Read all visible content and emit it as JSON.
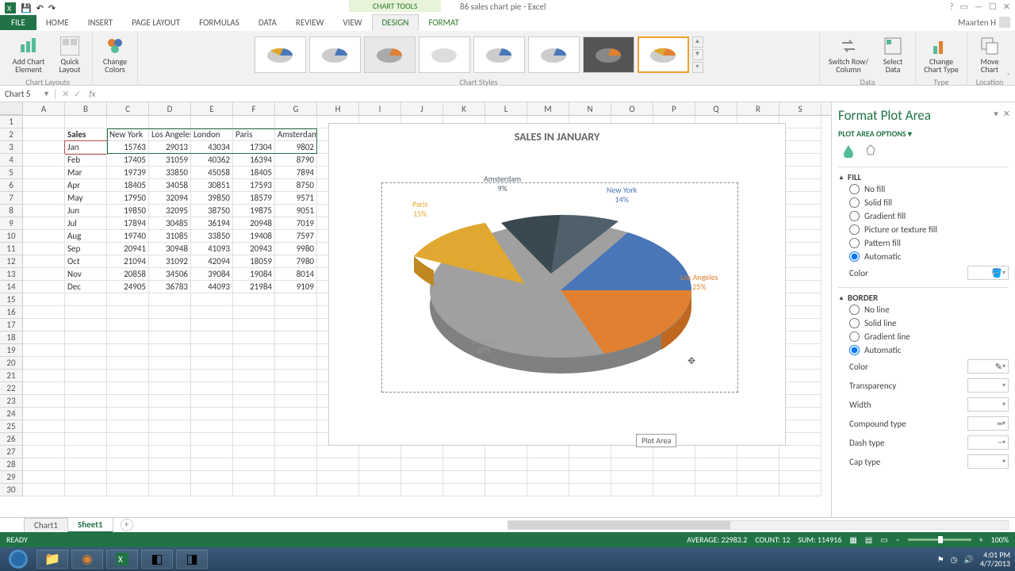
{
  "app": {
    "chart_tools": "CHART TOOLS",
    "doc_title": "86 sales chart pie - Excel",
    "user": "Maarten H"
  },
  "ribbon_tabs": {
    "file": "FILE",
    "home": "HOME",
    "insert": "INSERT",
    "page_layout": "PAGE LAYOUT",
    "formulas": "FORMULAS",
    "data": "DATA",
    "review": "REVIEW",
    "view": "VIEW",
    "design": "DESIGN",
    "format": "FORMAT"
  },
  "ribbon": {
    "add_chart_element": "Add Chart Element",
    "quick_layout": "Quick Layout",
    "change_colors": "Change Colors",
    "switch_row_col": "Switch Row/ Column",
    "select_data": "Select Data",
    "change_chart_type": "Change Chart Type",
    "move_chart": "Move Chart",
    "grp_layouts": "Chart Layouts",
    "grp_styles": "Chart Styles",
    "grp_data": "Data",
    "grp_type": "Type",
    "grp_location": "Location"
  },
  "name_box": "Chart 5",
  "columns": [
    "A",
    "B",
    "C",
    "D",
    "E",
    "F",
    "G",
    "H",
    "I",
    "J",
    "K",
    "L",
    "M",
    "N",
    "O",
    "P",
    "Q",
    "R",
    "S"
  ],
  "row_count": 30,
  "table": {
    "label": "Sales",
    "cities": [
      "New York",
      "Los Angeles",
      "London",
      "Paris",
      "Amsterdam"
    ],
    "rows": [
      {
        "m": "Jan",
        "v": [
          15763,
          29013,
          43034,
          17304,
          9802
        ]
      },
      {
        "m": "Feb",
        "v": [
          17405,
          31059,
          40362,
          16394,
          8790
        ]
      },
      {
        "m": "Mar",
        "v": [
          19739,
          33850,
          45058,
          18405,
          7894
        ]
      },
      {
        "m": "Apr",
        "v": [
          18405,
          34058,
          30851,
          17593,
          8750
        ]
      },
      {
        "m": "May",
        "v": [
          17950,
          32094,
          39850,
          18579,
          9571
        ]
      },
      {
        "m": "Jun",
        "v": [
          19850,
          32095,
          38750,
          19875,
          9051
        ]
      },
      {
        "m": "Jul",
        "v": [
          17894,
          30485,
          36194,
          20948,
          7019
        ]
      },
      {
        "m": "Aug",
        "v": [
          19740,
          31085,
          33850,
          19408,
          7597
        ]
      },
      {
        "m": "Sep",
        "v": [
          20941,
          30948,
          41093,
          20943,
          9980
        ]
      },
      {
        "m": "Oct",
        "v": [
          21094,
          31092,
          42094,
          18059,
          7980
        ]
      },
      {
        "m": "Nov",
        "v": [
          20858,
          34506,
          39084,
          19084,
          8014
        ]
      },
      {
        "m": "Dec",
        "v": [
          24905,
          36783,
          44093,
          21984,
          9109
        ]
      }
    ]
  },
  "chart": {
    "title": "SALES IN JANUARY",
    "tooltip": "Plot Area",
    "labels": {
      "ny": "New York",
      "ny_pct": "14%",
      "la": "Los Angeles",
      "la_pct": "25%",
      "lo": "London",
      "lo_pct": "37%",
      "pa": "Paris",
      "pa_pct": "15%",
      "am": "Amsterdam",
      "am_pct": "9%"
    }
  },
  "chart_data": {
    "type": "pie",
    "title": "SALES IN JANUARY",
    "categories": [
      "New York",
      "Los Angeles",
      "London",
      "Paris",
      "Amsterdam"
    ],
    "values": [
      15763,
      29013,
      43034,
      17304,
      9802
    ],
    "percentages": [
      14,
      25,
      37,
      15,
      9
    ],
    "colors": [
      "#4876b8",
      "#e08030",
      "#a0a0a0",
      "#e0a830",
      "#50606a"
    ]
  },
  "format_pane": {
    "title": "Format Plot Area",
    "options": "PLOT AREA OPTIONS",
    "fill_h": "FILL",
    "fill": {
      "no": "No fill",
      "solid": "Solid fill",
      "grad": "Gradient fill",
      "pict": "Picture or texture fill",
      "patt": "Pattern fill",
      "auto": "Automatic",
      "color": "Color"
    },
    "border_h": "BORDER",
    "border": {
      "no": "No line",
      "solid": "Solid line",
      "grad": "Gradient line",
      "auto": "Automatic",
      "color": "Color",
      "trans": "Transparency",
      "width": "Width",
      "compound": "Compound type",
      "dash": "Dash type",
      "cap": "Cap type"
    }
  },
  "sheets": {
    "chart1": "Chart1",
    "sheet1": "Sheet1"
  },
  "status": {
    "ready": "READY",
    "avg": "AVERAGE: 22983.2",
    "count": "COUNT: 12",
    "sum": "SUM: 114916",
    "zoom": "100%"
  },
  "taskbar": {
    "time": "4:01 PM",
    "date": "4/7/2013"
  }
}
